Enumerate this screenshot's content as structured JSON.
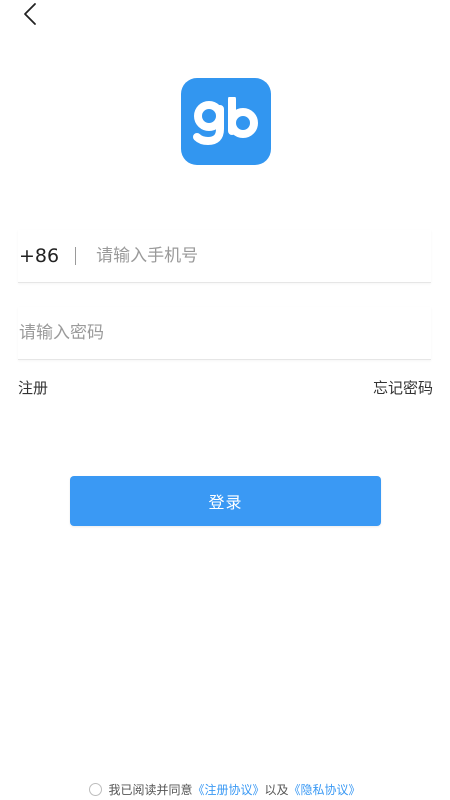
{
  "header": {
    "back_icon": "chevron-left-icon"
  },
  "logo": {
    "text": "gb",
    "color": "#3296f0"
  },
  "phone": {
    "country_code": "+86",
    "placeholder": "请输入手机号"
  },
  "password": {
    "placeholder": "请输入密码"
  },
  "links": {
    "register": "注册",
    "forgot_password": "忘记密码"
  },
  "login_button": {
    "label": "登录",
    "color": "#3a99f4"
  },
  "agreement": {
    "prefix": "我已阅读并同意",
    "terms_link": "《注册协议》",
    "conjunction": "以及",
    "privacy_link": "《隐私协议》",
    "link_color": "#3a99f4"
  }
}
